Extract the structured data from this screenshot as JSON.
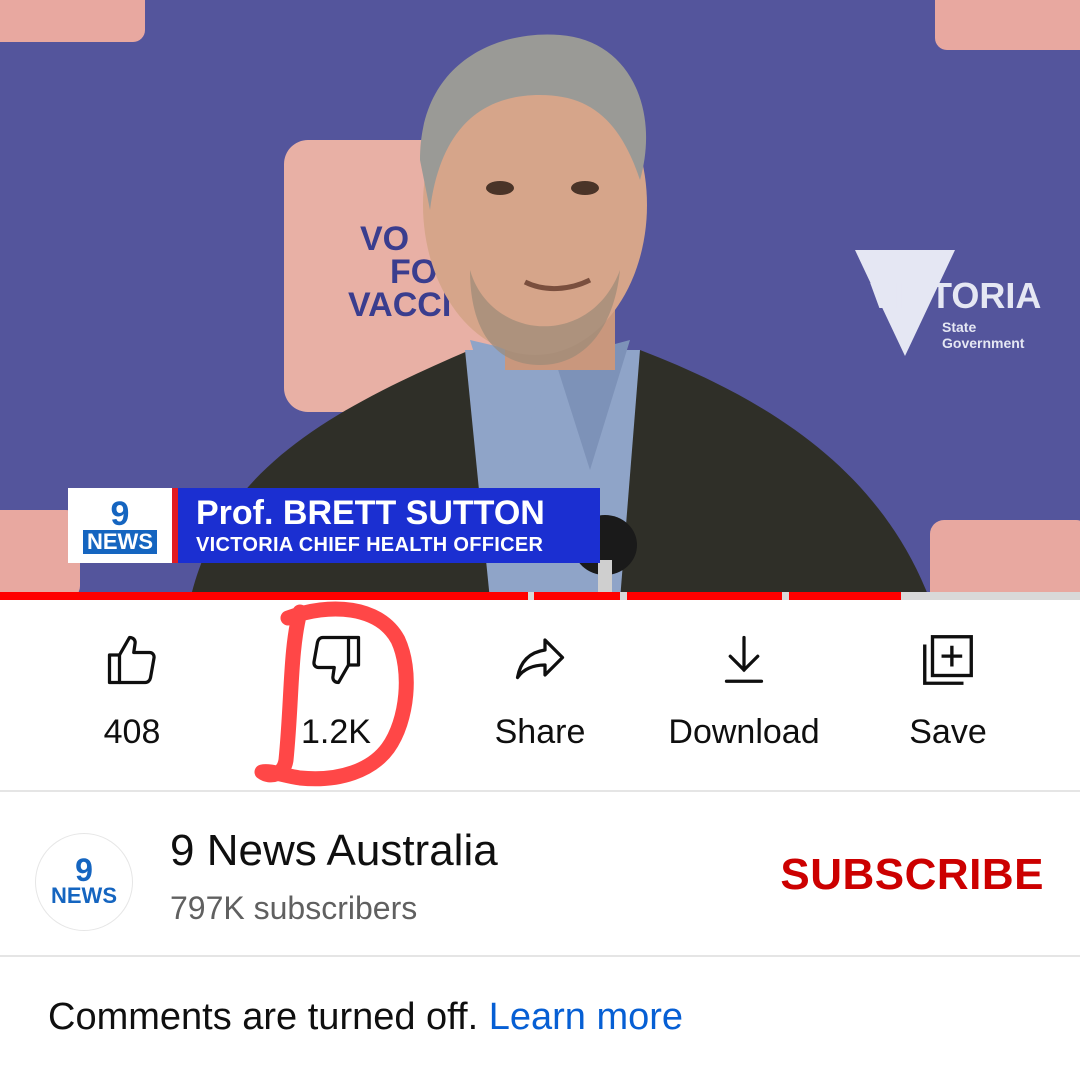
{
  "video": {
    "backdrop_text_left": "VOTE FOR VACCINES",
    "backdrop_text_right": "VICTORIA",
    "backdrop_text_right_sub": "State Government",
    "lower_third": {
      "logo_nine": "9",
      "logo_news": "NEWS",
      "name": "Prof. BRETT SUTTON",
      "title": "VICTORIA CHIEF HEALTH OFFICER"
    },
    "colors": {
      "backdrop": "#5a5aa0",
      "bar": "#1b2fd1",
      "accent": "#e11b22",
      "progress": "#ff0000"
    }
  },
  "actions": {
    "like": {
      "label": "408",
      "icon": "thumbs-up-icon"
    },
    "dislike": {
      "label": "1.2K",
      "icon": "thumbs-down-icon"
    },
    "share": {
      "label": "Share",
      "icon": "share-arrow-icon"
    },
    "download": {
      "label": "Download",
      "icon": "download-icon"
    },
    "save": {
      "label": "Save",
      "icon": "add-to-playlist-icon"
    }
  },
  "channel": {
    "avatar_nine": "9",
    "avatar_news": "NEWS",
    "name": "9 News Australia",
    "subscribers": "797K subscribers",
    "subscribe_label": "SUBSCRIBE",
    "subscribe_color": "#cc0000"
  },
  "comments": {
    "text": "Comments are turned off.",
    "link": "Learn more",
    "link_color": "#065fd4"
  },
  "annotation": {
    "shape": "hand-drawn red letter D around dislike",
    "color": "#ff4040"
  }
}
